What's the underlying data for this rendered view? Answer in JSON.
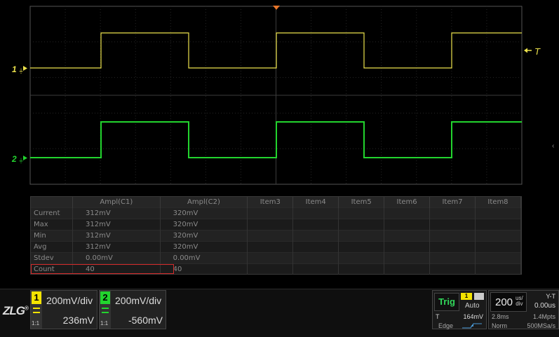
{
  "waveform": {
    "trigger_marker": "T",
    "channel_markers": [
      {
        "label": "1",
        "color": "#ece24c"
      },
      {
        "label": "2",
        "color": "#22d42e"
      }
    ]
  },
  "measurements": {
    "headers": [
      "",
      "Ampl(C1)",
      "Ampl(C2)",
      "Item3",
      "Item4",
      "Item5",
      "Item6",
      "Item7",
      "Item8"
    ],
    "rows": [
      {
        "label": "Current",
        "values": [
          "312mV",
          "320mV",
          "",
          "",
          "",
          "",
          "",
          ""
        ]
      },
      {
        "label": "Max",
        "values": [
          "312mV",
          "320mV",
          "",
          "",
          "",
          "",
          "",
          ""
        ]
      },
      {
        "label": "Min",
        "values": [
          "312mV",
          "320mV",
          "",
          "",
          "",
          "",
          "",
          ""
        ]
      },
      {
        "label": "Avg",
        "values": [
          "312mV",
          "320mV",
          "",
          "",
          "",
          "",
          "",
          ""
        ]
      },
      {
        "label": "Stdev",
        "values": [
          "0.00mV",
          "0.00mV",
          "",
          "",
          "",
          "",
          "",
          ""
        ]
      },
      {
        "label": "Count",
        "values": [
          "40",
          "40",
          "",
          "",
          "",
          "",
          "",
          ""
        ]
      }
    ],
    "highlighted_row": "Count"
  },
  "logo": {
    "text": "ZLG",
    "mark": "®"
  },
  "channels": [
    {
      "number": "1",
      "scale": "200mV/div",
      "offset": "236mV",
      "impedance": "1:1",
      "color": "#f4e400"
    },
    {
      "number": "2",
      "scale": "200mV/div",
      "offset": "-560mV",
      "impedance": "1:1",
      "color": "#22d42e"
    }
  ],
  "trigger": {
    "label": "Trig",
    "source": "1",
    "mode": "Auto",
    "level_label": "T",
    "level": "164mV",
    "type": "Edge"
  },
  "timebase": {
    "value": "200",
    "unit_top": "us/",
    "unit_bottom": "div",
    "mode": "Y-T",
    "delay": "0.00us",
    "window": "2.8ms",
    "memory": "1.4Mpts",
    "acq_mode": "Norm",
    "sample_rate": "500MSa/s"
  }
}
